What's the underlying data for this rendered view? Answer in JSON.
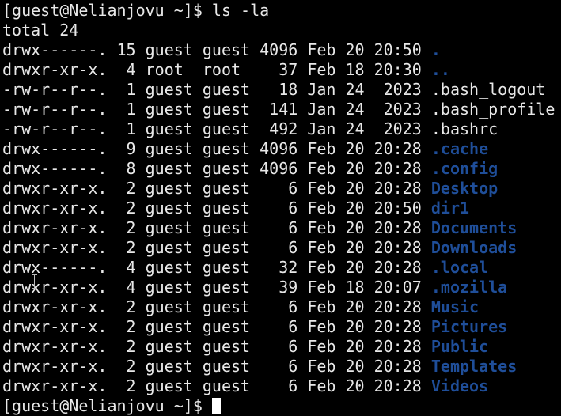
{
  "prompt": "[guest@Nelianjovu ~]$ ",
  "command": "ls -la",
  "total": "total 24",
  "entries": [
    {
      "meta": "drwx------. 15 guest guest 4096 Feb 20 20:50 ",
      "name": ".",
      "kind": "dir"
    },
    {
      "meta": "drwxr-xr-x.  4 root  root    37 Feb 18 20:30 ",
      "name": "..",
      "kind": "dir"
    },
    {
      "meta": "-rw-r--r--.  1 guest guest   18 Jan 24  2023 ",
      "name": ".bash_logout",
      "kind": "file"
    },
    {
      "meta": "-rw-r--r--.  1 guest guest  141 Jan 24  2023 ",
      "name": ".bash_profile",
      "kind": "file"
    },
    {
      "meta": "-rw-r--r--.  1 guest guest  492 Jan 24  2023 ",
      "name": ".bashrc",
      "kind": "file"
    },
    {
      "meta": "drwx------.  9 guest guest 4096 Feb 20 20:28 ",
      "name": ".cache",
      "kind": "dir"
    },
    {
      "meta": "drwx------.  8 guest guest 4096 Feb 20 20:28 ",
      "name": ".config",
      "kind": "dir"
    },
    {
      "meta": "drwxr-xr-x.  2 guest guest    6 Feb 20 20:28 ",
      "name": "Desktop",
      "kind": "dir"
    },
    {
      "meta": "drwxr-xr-x.  2 guest guest    6 Feb 20 20:50 ",
      "name": "dir1",
      "kind": "dir"
    },
    {
      "meta": "drwxr-xr-x.  2 guest guest    6 Feb 20 20:28 ",
      "name": "Documents",
      "kind": "dir"
    },
    {
      "meta": "drwxr-xr-x.  2 guest guest    6 Feb 20 20:28 ",
      "name": "Downloads",
      "kind": "dir"
    },
    {
      "meta": "drwx------.  4 guest guest   32 Feb 20 20:28 ",
      "name": ".local",
      "kind": "dir"
    },
    {
      "meta": "drwxr-xr-x.  4 guest guest   39 Feb 18 20:07 ",
      "name": ".mozilla",
      "kind": "dir"
    },
    {
      "meta": "drwxr-xr-x.  2 guest guest    6 Feb 20 20:28 ",
      "name": "Music",
      "kind": "dir"
    },
    {
      "meta": "drwxr-xr-x.  2 guest guest    6 Feb 20 20:28 ",
      "name": "Pictures",
      "kind": "dir"
    },
    {
      "meta": "drwxr-xr-x.  2 guest guest    6 Feb 20 20:28 ",
      "name": "Public",
      "kind": "dir"
    },
    {
      "meta": "drwxr-xr-x.  2 guest guest    6 Feb 20 20:28 ",
      "name": "Templates",
      "kind": "dir"
    },
    {
      "meta": "drwxr-xr-x.  2 guest guest    6 Feb 20 20:28 ",
      "name": "Videos",
      "kind": "dir"
    }
  ],
  "final_prompt": "[guest@Nelianjovu ~]$ ",
  "colors": {
    "background": "#000000",
    "foreground": "#e8e8e8",
    "directory": "#1f4e99",
    "cursor": "#ffffff"
  },
  "icons": {
    "mouse_pointer": "text-ibeam-cursor-icon",
    "caret": "block-caret-icon"
  }
}
